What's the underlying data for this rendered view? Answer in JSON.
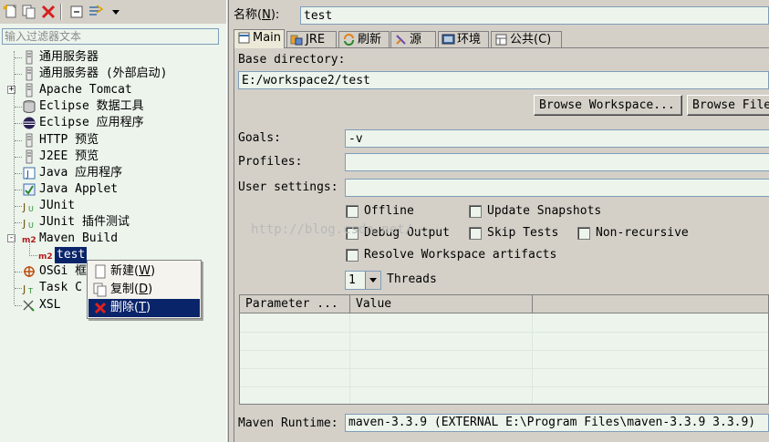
{
  "left": {
    "filter_placeholder": "输入过滤器文本",
    "tree": [
      {
        "label": "通用服务器",
        "icon": "server-icon"
      },
      {
        "label": "通用服务器 (外部启动)",
        "icon": "server-icon"
      },
      {
        "label": "Apache Tomcat",
        "icon": "server-icon",
        "expander": "+"
      },
      {
        "label": "Eclipse 数据工具",
        "icon": "database-icon"
      },
      {
        "label": "Eclipse 应用程序",
        "icon": "eclipse-icon"
      },
      {
        "label": "HTTP 预览",
        "icon": "server-icon"
      },
      {
        "label": "J2EE 预览",
        "icon": "server-icon"
      },
      {
        "label": "Java 应用程序",
        "icon": "java-app-icon"
      },
      {
        "label": "Java Applet",
        "icon": "applet-icon"
      },
      {
        "label": "JUnit",
        "icon": "junit-icon"
      },
      {
        "label": "JUnit 插件测试",
        "icon": "junit-icon"
      },
      {
        "label": "Maven Build",
        "icon": "maven-icon",
        "expander": "-"
      },
      {
        "label": "test",
        "icon": "maven-icon",
        "child": true,
        "selected": true
      },
      {
        "label": "OSGi 框",
        "icon": "osgi-icon"
      },
      {
        "label": "Task C",
        "icon": "task-icon"
      },
      {
        "label": "XSL",
        "icon": "xsl-icon"
      }
    ],
    "context_menu": {
      "new_label": "新建",
      "new_key": "W",
      "copy_label": "复制",
      "copy_key": "D",
      "delete_label": "删除",
      "delete_key": "T"
    }
  },
  "right": {
    "name_label": "名称",
    "name_key": "N",
    "name_value": "test",
    "tabs": [
      {
        "label": "Main",
        "icon": "main-icon"
      },
      {
        "label": "JRE",
        "icon": "jre-icon"
      },
      {
        "label": "刷新",
        "icon": "refresh-icon"
      },
      {
        "label": "源",
        "icon": "source-icon"
      },
      {
        "label": "环境",
        "icon": "environment-icon"
      },
      {
        "label": "公共",
        "key": "C",
        "icon": "common-icon"
      }
    ],
    "base_directory_label": "Base directory:",
    "base_directory_value": "E:/workspace2/test",
    "browse_workspace_label": "Browse Workspace...",
    "browse_file_label": "Browse File",
    "goals_label": "Goals:",
    "goals_value": "-v",
    "profiles_label": "Profiles:",
    "profiles_value": "",
    "user_settings_label": "User settings:",
    "user_settings_value": "",
    "options": {
      "offline": "Offline",
      "update_snapshots": "Update Snapshots",
      "debug_output": "Debug Output",
      "skip_tests": "Skip Tests",
      "non_recursive": "Non-recursive",
      "resolve_workspace": "Resolve Workspace artifacts"
    },
    "threads_value": "1",
    "threads_label": "Threads",
    "table_headers": [
      "Parameter ...",
      "Value"
    ],
    "runtime_label": "Maven Runtime:",
    "runtime_value": "maven-3.3.9 (EXTERNAL E:\\Program Files\\maven-3.3.9 3.3.9)"
  },
  "watermark": "http://blog.csdn.net/..."
}
